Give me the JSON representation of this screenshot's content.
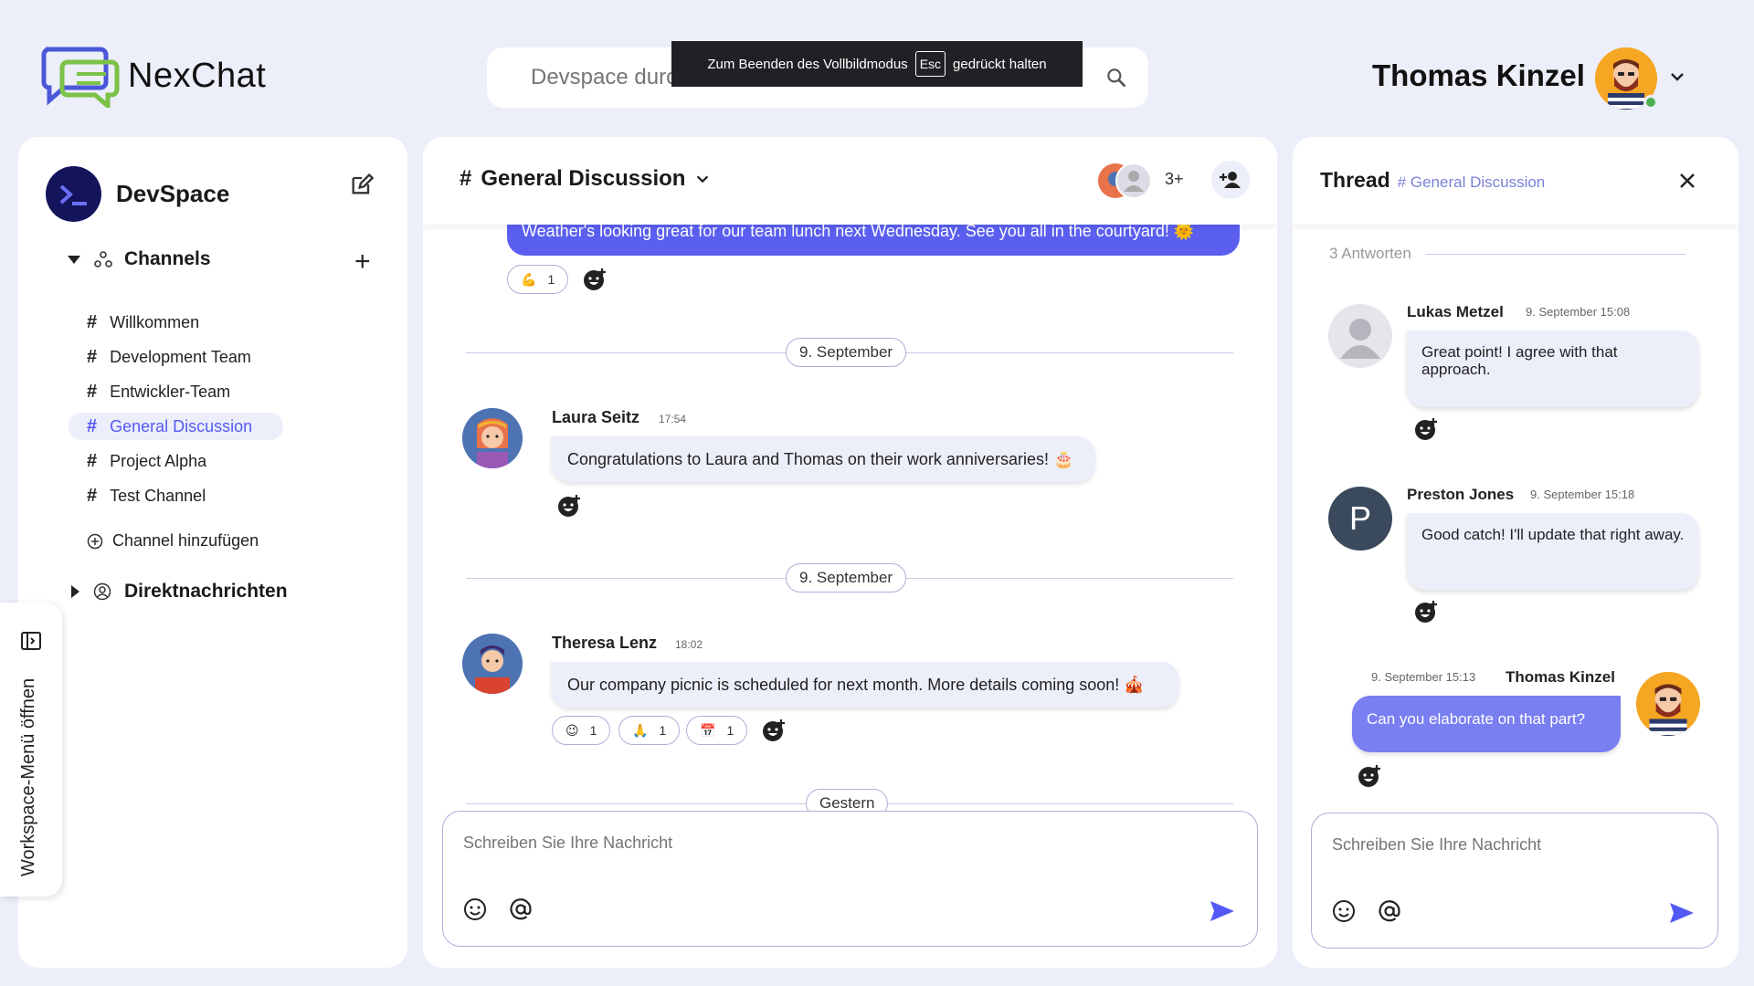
{
  "app": {
    "name": "NexChat"
  },
  "search": {
    "placeholder": "Devspace durchsuchen"
  },
  "fullscreen_toast": {
    "before": "Zum Beenden des Vollbildmodus",
    "key": "Esc",
    "after": "gedrückt halten"
  },
  "user": {
    "name": "Thomas Kinzel",
    "status": "online"
  },
  "sidebar": {
    "workspace": "DevSpace",
    "channels_label": "Channels",
    "channels": [
      {
        "label": "Willkommen",
        "active": false
      },
      {
        "label": "Development Team",
        "active": false
      },
      {
        "label": "Entwickler-Team",
        "active": false
      },
      {
        "label": "General Discussion",
        "active": true
      },
      {
        "label": "Project Alpha",
        "active": false
      },
      {
        "label": "Test Channel",
        "active": false
      }
    ],
    "add_channel": "Channel hinzufügen",
    "dm_label": "Direktnachrichten",
    "workspace_menu": "Workspace-Menü öffnen"
  },
  "chat": {
    "channel": "General Discussion",
    "member_count": "3+",
    "top_message": "Weather's looking great for our team lunch next Wednesday. See you all in the courtyard! 🌞",
    "top_reactions": [
      {
        "emoji": "💪",
        "count": "1"
      }
    ],
    "date1": "9. September",
    "msg1": {
      "name": "Laura Seitz",
      "time": "17:54",
      "text": "Congratulations to Laura and Thomas on their work anniversaries! 🎂"
    },
    "date2": "9. September",
    "msg2": {
      "name": "Theresa Lenz",
      "time": "18:02",
      "text": "Our company picnic is scheduled for next month. More details coming soon! 🎪",
      "reactions": [
        {
          "emoji": "😉",
          "count": "1"
        },
        {
          "emoji": "🙏",
          "count": "1"
        },
        {
          "emoji": "📅",
          "count": "1"
        }
      ]
    },
    "date3": "Gestern",
    "composer_placeholder": "Schreiben Sie Ihre Nachricht"
  },
  "thread": {
    "title": "Thread",
    "channel": "# General Discussion",
    "answers": "3 Antworten",
    "messages": [
      {
        "name": "Lukas Metzel",
        "time": "9. September 15:08",
        "text": "Great point! I agree with that approach."
      },
      {
        "name": "Preston Jones",
        "time": "9. September 15:18",
        "text": "Good catch! I'll update that right away.",
        "initial": "P"
      },
      {
        "name": "Thomas Kinzel",
        "time": "9. September 15:13",
        "text": "Can you elaborate on that part?"
      }
    ],
    "composer_placeholder": "Schreiben Sie Ihre Nachricht"
  },
  "colors": {
    "accent": "#535af4",
    "background": "#eceefa",
    "own_bubble": "#797ef1"
  }
}
